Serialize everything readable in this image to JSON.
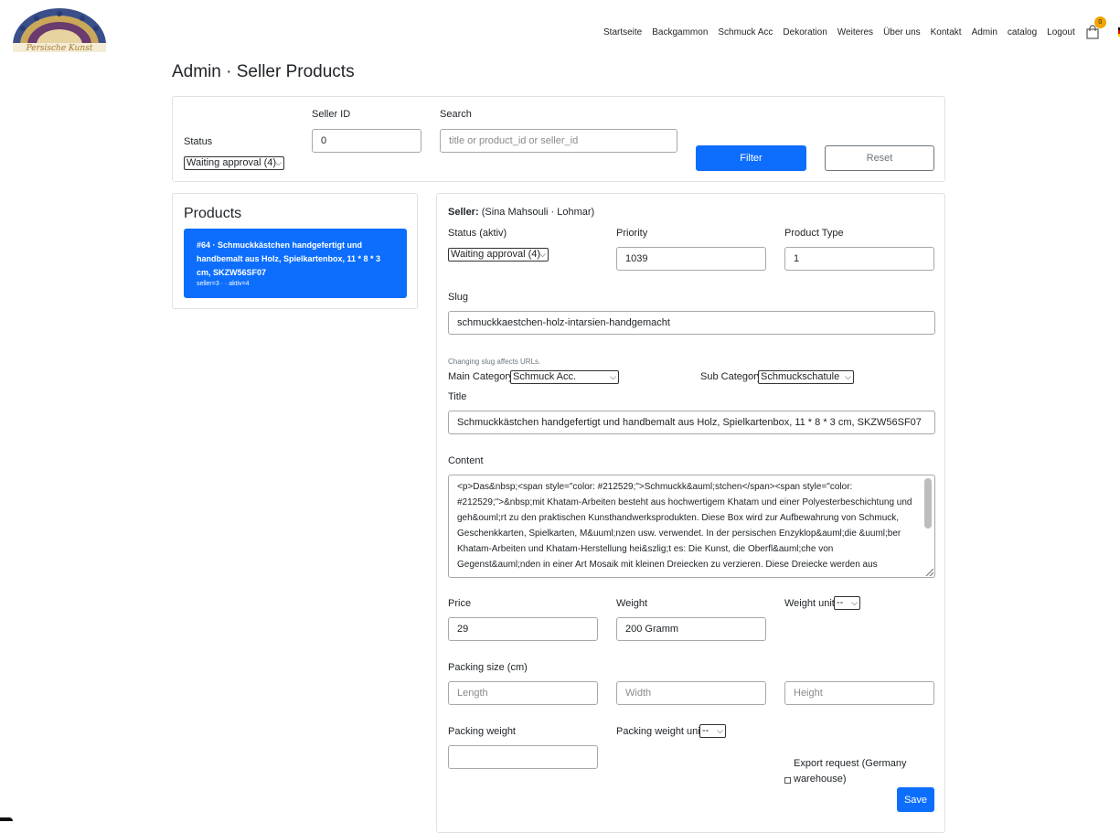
{
  "brand": {
    "logo_text": "Persische Kunst"
  },
  "nav": {
    "items": [
      "Startseite",
      "Backgammon",
      "Schmuck Acc",
      "Dekoration",
      "Weiteres",
      "Über uns",
      "Kontakt",
      "Admin",
      "catalog",
      "Logout"
    ],
    "cart_count": "0",
    "language": "De"
  },
  "page": {
    "title": "Admin · Seller Products"
  },
  "filter": {
    "status_label": "Status",
    "status_value": "Waiting approval (4)",
    "seller_id_label": "Seller ID",
    "seller_id_value": "0",
    "search_label": "Search",
    "search_placeholder": "title or product_id or seller_id",
    "filter_button": "Filter",
    "reset_button": "Reset"
  },
  "products": {
    "heading": "Products",
    "items": [
      {
        "title": "#64 · Schmuckkästchen handgefertigt und handbemalt aus Holz, Spielkartenbox, 11 * 8 * 3 cm, SKZW56SF07",
        "meta": "seller=3 · · aktiv=4"
      }
    ]
  },
  "edit": {
    "seller_label": "Seller:",
    "seller_value": "(Sina Mahsouli · Lohmar)",
    "status_label": "Status (aktiv)",
    "status_value": "Waiting approval (4)",
    "priority_label": "Priority",
    "priority_value": "1039",
    "product_type_label": "Product Type",
    "product_type_value": "1",
    "slug_label": "Slug",
    "slug_value": "schmuckkaestchen-holz-intarsien-handgemacht",
    "slug_hint": "Changing slug affects URLs.",
    "main_category_label": "Main Category",
    "main_category_value": "Schmuck Acc.",
    "sub_category_label": "Sub Category",
    "sub_category_value": "Schmuckschatule",
    "title_label": "Title",
    "title_value": "Schmuckkästchen handgefertigt und handbemalt aus Holz, Spielkartenbox, 11 * 8 * 3 cm, SKZW56SF07",
    "content_label": "Content",
    "content_value": "<p>Das&nbsp;<span style=\"color: #212529;\">Schmuckk&auml;stchen</span><span style=\"color: #212529;\">&nbsp;mit Khatam-Arbeiten besteht aus hochwertigem Khatam und einer Polyesterbeschichtung und geh&ouml;rt zu den praktischen Kunsthandwerksprodukten. Diese Box wird zur Aufbewahrung von Schmuck, Geschenkkarten, Spielkarten, M&uuml;nzen usw. verwendet. In der persischen Enzyklop&auml;die &uuml;ber Khatam-Arbeiten und Khatam-Herstellung hei&szlig;t es: Die Kunst, die Oberfl&auml;che von Gegenst&auml;nden in einer Art Mosaik mit kleinen Dreiecken zu verzieren. Diese Dreiecke werden aus",
    "price_label": "Price",
    "price_value": "29",
    "weight_label": "Weight",
    "weight_value": "200 Gramm",
    "weight_unit_label": "Weight unit",
    "weight_unit_value": "--",
    "packing_size_label": "Packing size (cm)",
    "length_placeholder": "Length",
    "width_placeholder": "Width",
    "height_placeholder": "Height",
    "packing_weight_label": "Packing weight",
    "packing_weight_value": "",
    "packing_weight_unit_label": "Packing weight unit",
    "packing_weight_unit_value": "--",
    "export_label_line1": "Export request (Germany",
    "export_label_line2": "warehouse)",
    "save_button": "Save"
  },
  "colors": {
    "primary": "#0d6efd",
    "badge": "#f0a500",
    "border": "#dee2e6"
  }
}
